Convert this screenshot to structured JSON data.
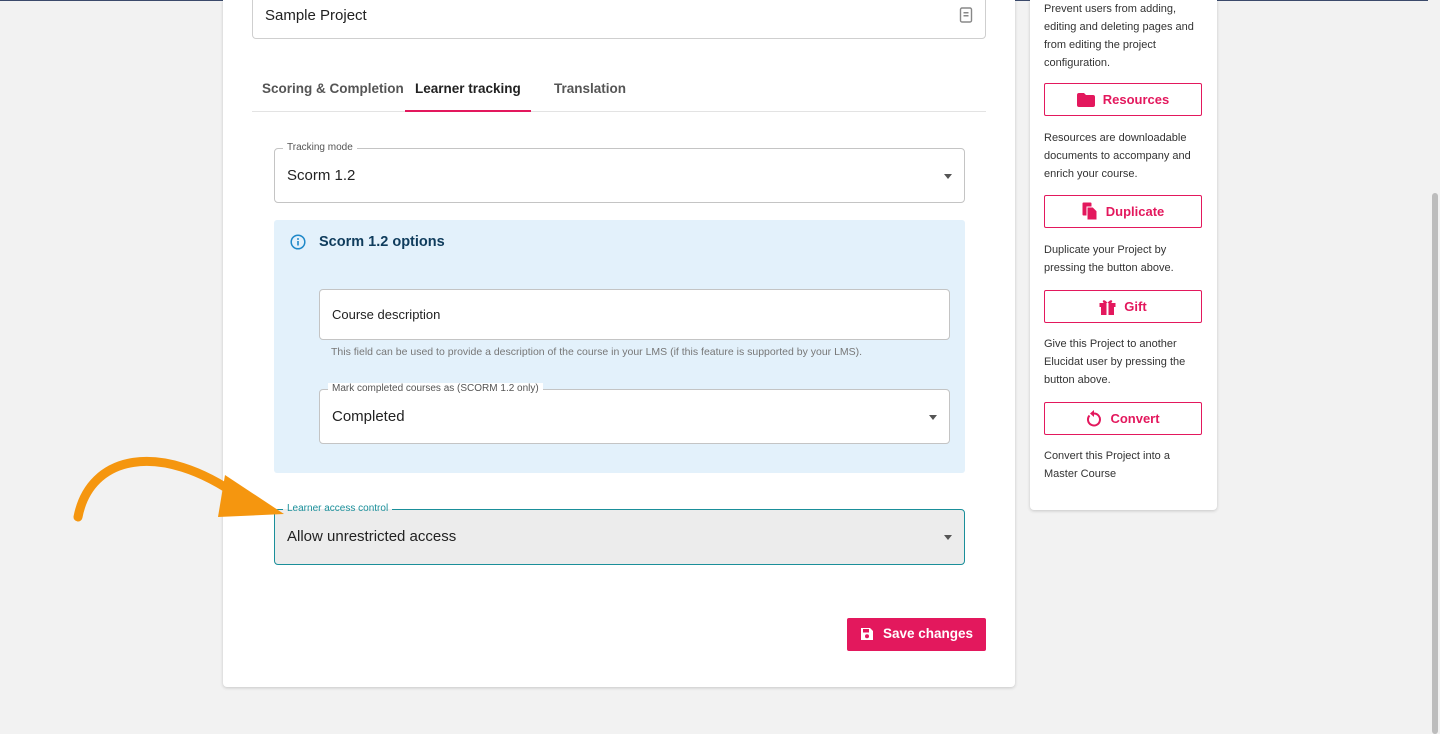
{
  "project": {
    "name_value": "Sample Project"
  },
  "tabs": [
    {
      "label": "Scoring & Completion",
      "active": false
    },
    {
      "label": "Learner tracking",
      "active": true
    },
    {
      "label": "Translation",
      "active": false
    }
  ],
  "tracking_mode": {
    "label": "Tracking mode",
    "value": "Scorm 1.2"
  },
  "scorm_options": {
    "title": "Scorm 1.2 options",
    "course_description": {
      "placeholder": "Course description",
      "helper": "This field can be used to provide a description of the course in your LMS (if this feature is supported by your LMS)."
    },
    "mark_completed": {
      "label": "Mark completed courses as (SCORM 1.2 only)",
      "value": "Completed"
    }
  },
  "learner_access": {
    "label": "Learner access control",
    "value": "Allow unrestricted access"
  },
  "save_button": {
    "label": "Save changes"
  },
  "side_panel": {
    "intro_text": "Prevent users from adding, editing and deleting pages and from editing the project configuration.",
    "buttons": [
      {
        "label": "Resources",
        "icon": "folder-icon",
        "description": "Resources are downloadable documents to accompany and enrich your course."
      },
      {
        "label": "Duplicate",
        "icon": "copy-icon",
        "description": "Duplicate your Project by pressing the button above."
      },
      {
        "label": "Gift",
        "icon": "gift-icon",
        "description": "Give this Project to another Elucidat user by pressing the button above."
      },
      {
        "label": "Convert",
        "icon": "convert-icon",
        "description": "Convert this Project into a Master Course"
      }
    ]
  },
  "colors": {
    "accent": "#e3185d",
    "info_bg": "#e3f1fb",
    "focus": "#1a8f9a",
    "annotation_arrow": "#f5960f"
  }
}
